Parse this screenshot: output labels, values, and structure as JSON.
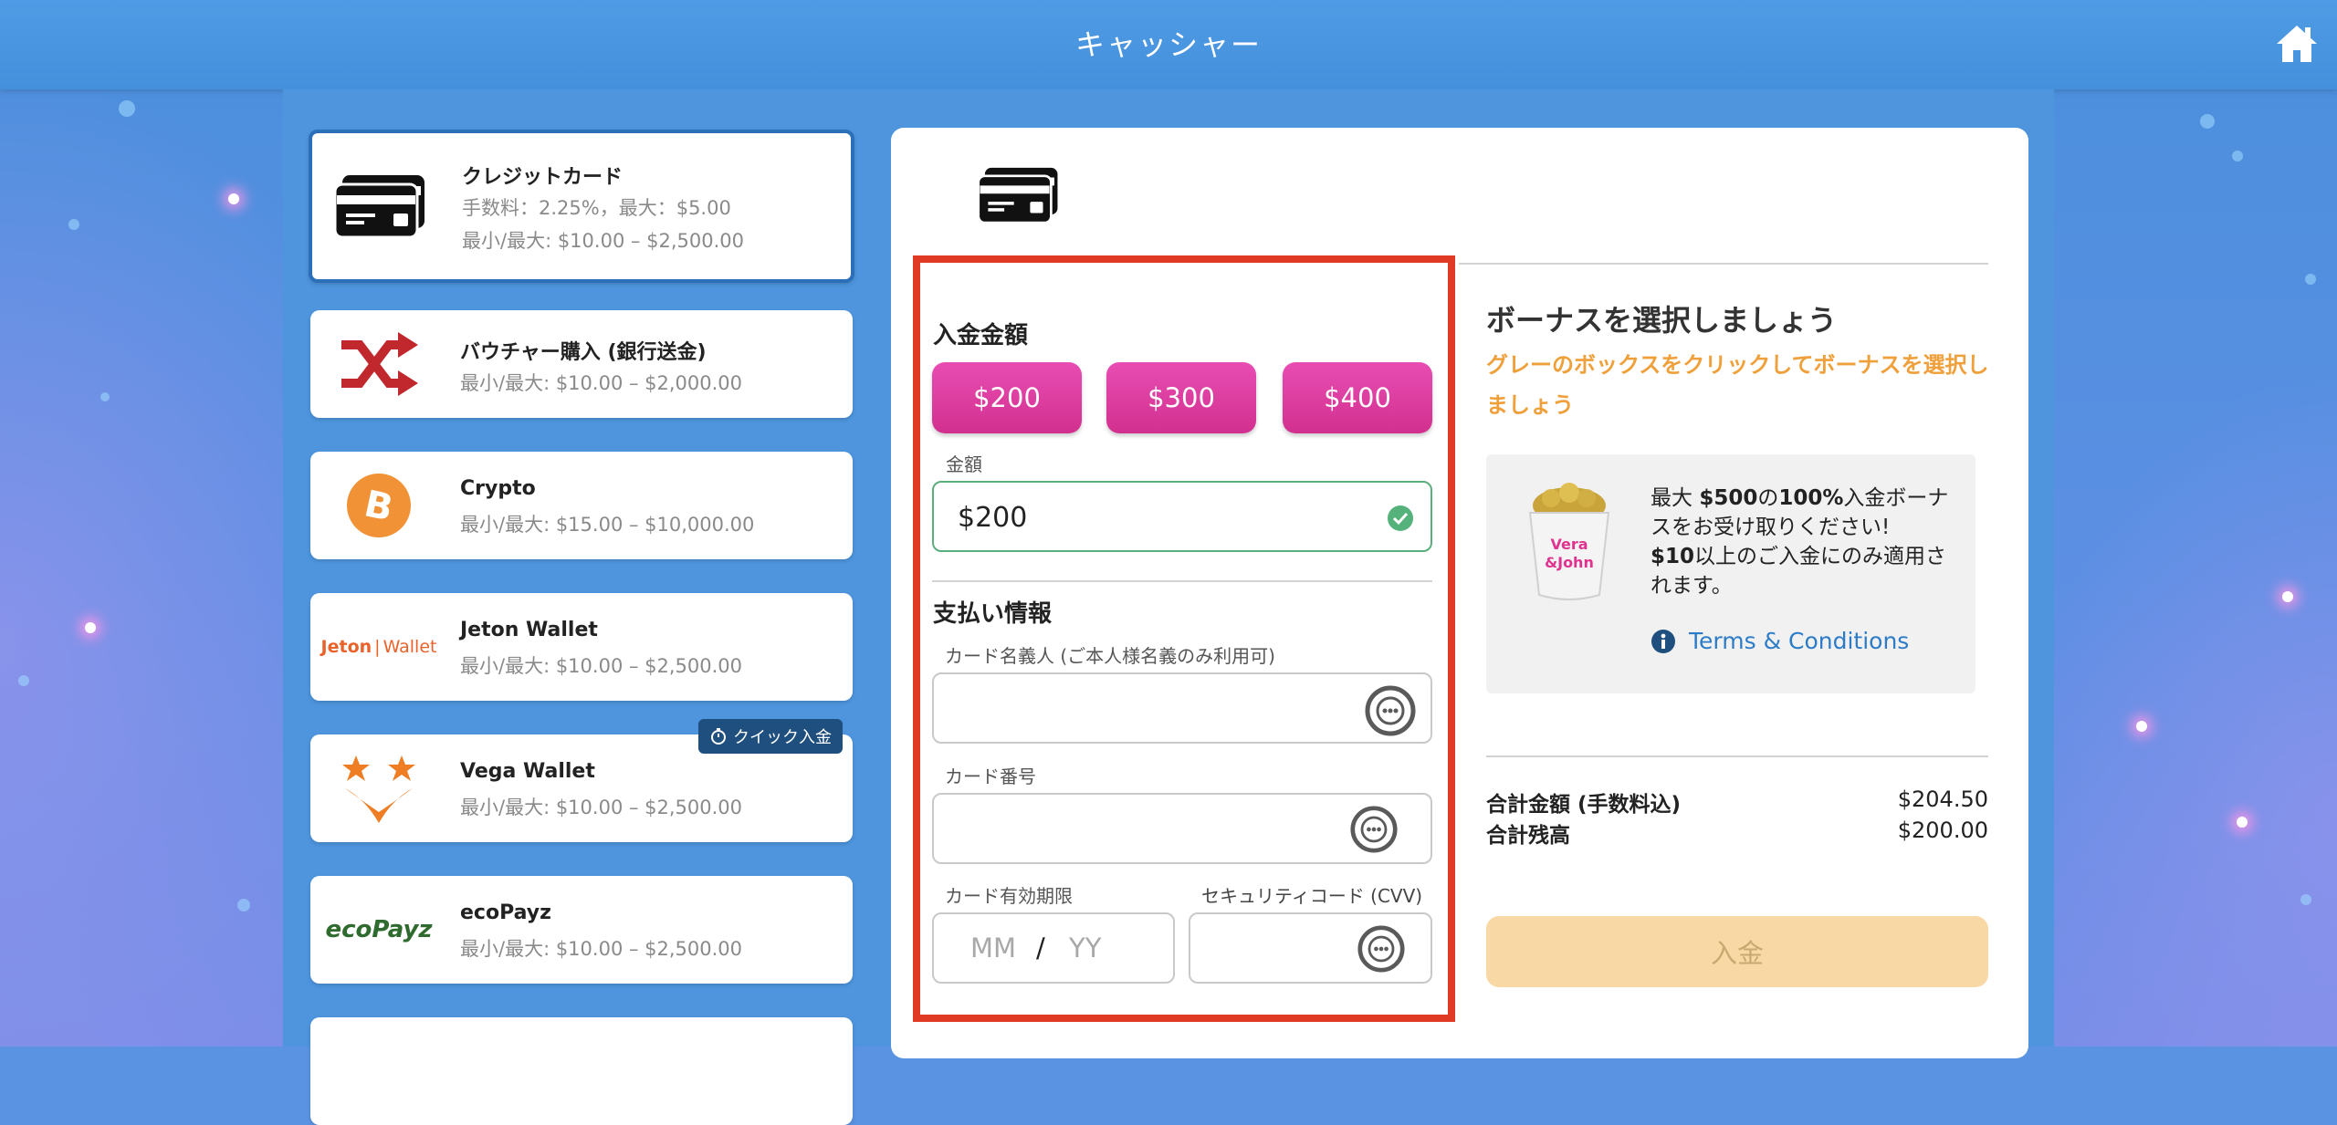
{
  "header": {
    "title": "キャッシャー"
  },
  "methods": [
    {
      "name": "クレジットカード",
      "line1": "手数料：2.25%，最大：$5.00",
      "line2": "最小/最大: $10.00 – $2,500.00"
    },
    {
      "name": "バウチャー購入 (銀行送金)",
      "line1": "最小/最大: $10.00 – $2,000.00"
    },
    {
      "name": "Crypto",
      "line1": "最小/最大: $15.00 – $10,000.00"
    },
    {
      "name": "Jeton Wallet",
      "line1": "最小/最大: $10.00 – $2,500.00",
      "logo_text_a": "Jeton",
      "logo_text_b": "Wallet"
    },
    {
      "name": "Vega Wallet",
      "line1": "最小/最大: $10.00 – $2,500.00",
      "badge": "クイック入金"
    },
    {
      "name": "ecoPayz",
      "line1": "最小/最大: $10.00 – $2,500.00",
      "logo_text": "ecoPayz"
    }
  ],
  "deposit": {
    "amount_title": "入金金額",
    "quick_amounts": [
      "$200",
      "$300",
      "$400"
    ],
    "amount_label": "金額",
    "amount_value": "$200",
    "payment_title": "支払い情報",
    "card_holder_label": "カード名義人 (ご本人様名義のみ利用可)",
    "card_number_label": "カード番号",
    "expiry_label": "カード有効期限",
    "expiry_mm": "MM",
    "expiry_sep": "/",
    "expiry_yy": "YY",
    "cvv_label": "セキュリティコード (CVV)"
  },
  "bonus": {
    "title": "ボーナスを選択しましょう",
    "subtitle": "グレーのボックスをクリックしてボーナスを選択しましょう",
    "text_a": "最大 ",
    "text_b": "$500",
    "text_c": "の",
    "text_d": "100%",
    "text_e": "入金ボーナスをお受け取りください!",
    "text_f": "$10",
    "text_g": "以上のご入金にのみ適用されます。",
    "bucket_label": "Vera&John",
    "terms": "Terms & Conditions"
  },
  "summary": {
    "total_label": "合計金額 (手数料込)",
    "total_value": "$204.50",
    "balance_label": "合計残高",
    "balance_value": "$200.00"
  },
  "deposit_button": "入金",
  "colors": {
    "accent_pink": "#d2308f",
    "highlight_red": "#e03a25",
    "bonus_orange": "#f0a03b",
    "link_blue": "#2d7cc7"
  }
}
